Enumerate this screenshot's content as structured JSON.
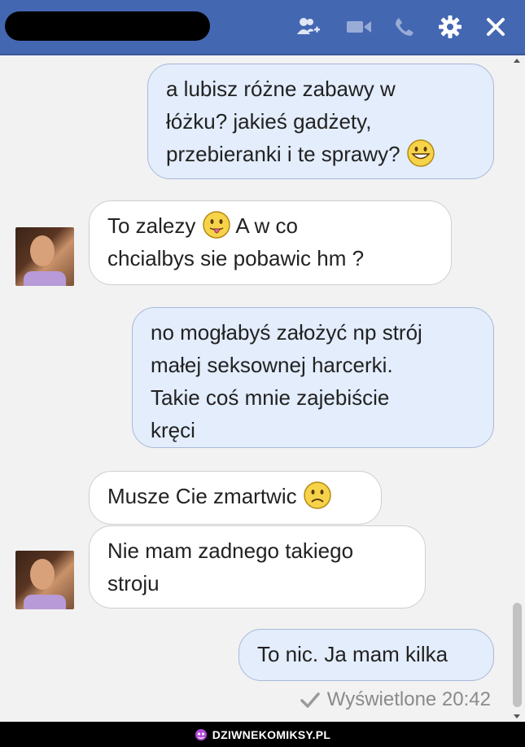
{
  "header": {
    "icons": {
      "add_people": "add-people-icon",
      "video": "video-call-icon",
      "phone": "phone-call-icon",
      "settings": "gear-icon",
      "close": "close-icon"
    },
    "color": "#4467b2"
  },
  "messages": [
    {
      "direction": "outgoing",
      "lines": [
        "a lubisz różne zabawy w",
        "łóżku? jakieś gadżety,",
        "przebieranki i te sprawy?"
      ],
      "emoji": "grin"
    },
    {
      "direction": "incoming",
      "line1": "To zalezy",
      "line1_after": "A w co",
      "line2": "chcialbys sie pobawic hm ?",
      "emoji": "tongue"
    },
    {
      "direction": "outgoing",
      "lines": [
        "no mogłabyś założyć np strój",
        "małej seksownej harcerki.",
        "Takie coś mnie zajebiście",
        "kręci"
      ]
    },
    {
      "direction": "incoming",
      "lines": [
        "Musze Cie zmartwic"
      ],
      "emoji": "sad"
    },
    {
      "direction": "incoming",
      "lines": [
        "Nie mam zadnego takiego",
        "stroju"
      ]
    },
    {
      "direction": "outgoing",
      "lines": [
        "To nic. Ja mam kilka"
      ]
    }
  ],
  "status": {
    "seen_label": "Wyświetlone 20:42"
  },
  "footer": {
    "watermark": "DZIWNEKOMIKSY.PL"
  },
  "colors": {
    "outgoing_bubble": "#e3edfc",
    "incoming_bubble": "#ffffff",
    "chat_background": "#f2f2f2"
  }
}
